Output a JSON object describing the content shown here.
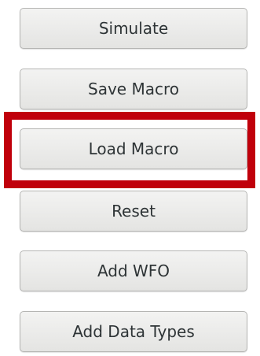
{
  "buttons": {
    "simulate": "Simulate",
    "save_macro": "Save Macro",
    "load_macro": "Load Macro",
    "reset": "Reset",
    "add_wfo": "Add WFO",
    "add_data_types": "Add Data Types"
  },
  "colors": {
    "highlight": "#c0000b",
    "button_bg": "#e9e9e7",
    "button_border": "#b5b5b3",
    "text": "#2e3436"
  }
}
